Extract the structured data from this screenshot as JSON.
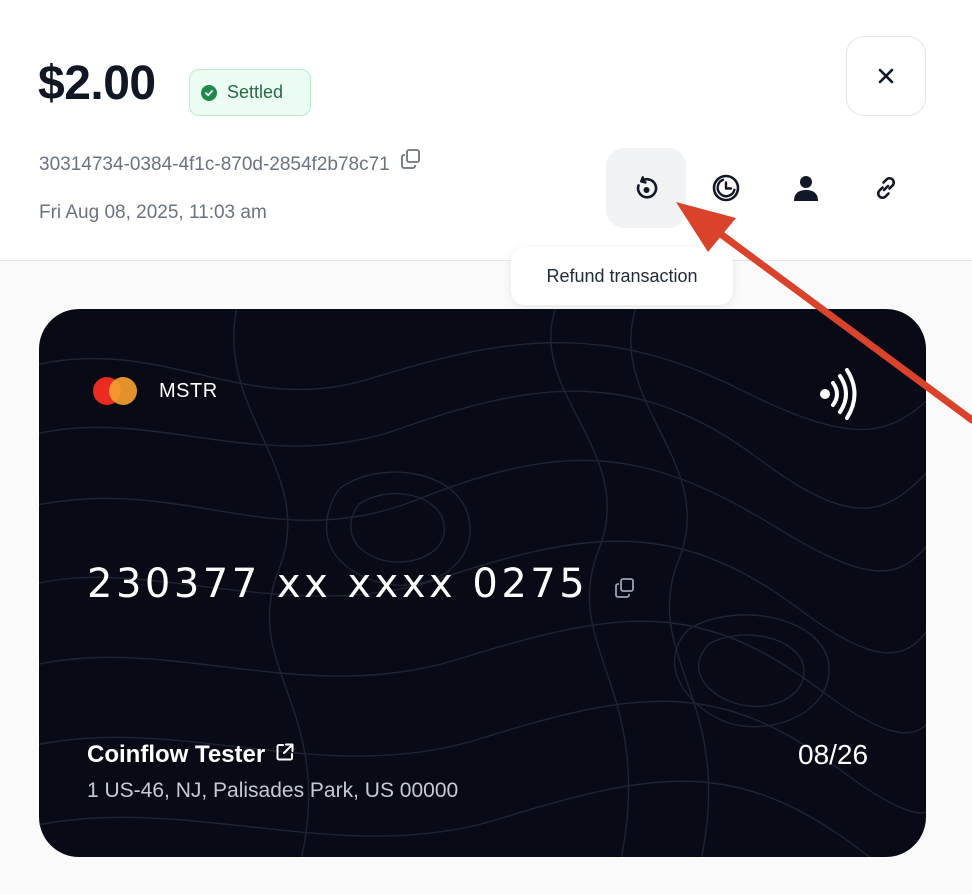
{
  "transaction": {
    "amount": "$2.00",
    "status": "Settled",
    "id": "30314734-0384-4f1c-870d-2854f2b78c71",
    "date": "Fri Aug 08, 2025, 11:03 am"
  },
  "actions": {
    "tooltip": "Refund transaction"
  },
  "card": {
    "brand": "MSTR",
    "number": "230377 xx xxxx 0275",
    "holder": "Coinflow Tester",
    "address": "1 US-46, NJ, Palisades Park, US 00000",
    "expiry": "08/26"
  },
  "colors": {
    "status_green": "#1f8a4c",
    "card_background": "#080b16",
    "annotation_arrow": "#d9432c"
  },
  "icons": {
    "close": "close-icon",
    "copy": "copy-icon",
    "refund": "refund-icon",
    "dispute": "dispute-icon",
    "customer": "user-icon",
    "link": "link-icon",
    "contactless": "contactless-icon",
    "external": "external-link-icon"
  }
}
